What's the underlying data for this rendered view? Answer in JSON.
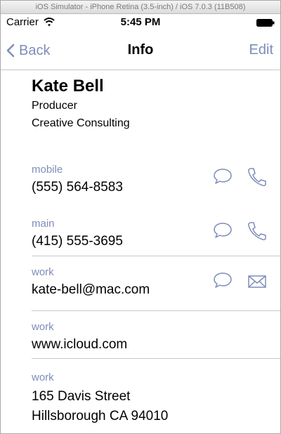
{
  "simulator": {
    "title": "iOS Simulator - iPhone Retina (3.5-inch) / iOS 7.0.3 (11B508)"
  },
  "status_bar": {
    "carrier": "Carrier",
    "time": "5:45 PM"
  },
  "nav": {
    "back_label": "Back",
    "title": "Info",
    "edit_label": "Edit"
  },
  "contact": {
    "name": "Kate Bell",
    "job_title": "Producer",
    "company": "Creative Consulting"
  },
  "fields": [
    {
      "label": "mobile",
      "value": "(555) 564-8583",
      "actions": [
        "message-icon",
        "phone-icon"
      ]
    },
    {
      "label": "main",
      "value": "(415) 555-3695",
      "actions": [
        "message-icon",
        "phone-icon"
      ]
    },
    {
      "label": "work",
      "value": "kate-bell@mac.com",
      "actions": [
        "message-icon",
        "mail-icon"
      ]
    },
    {
      "label": "work",
      "value": "www.icloud.com",
      "actions": []
    },
    {
      "label": "work",
      "value_line1": "165 Davis Street",
      "value_line2": "Hillsborough CA 94010",
      "actions": []
    }
  ],
  "colors": {
    "tint": "#7e8db8",
    "separator": "#c8c7cc"
  }
}
